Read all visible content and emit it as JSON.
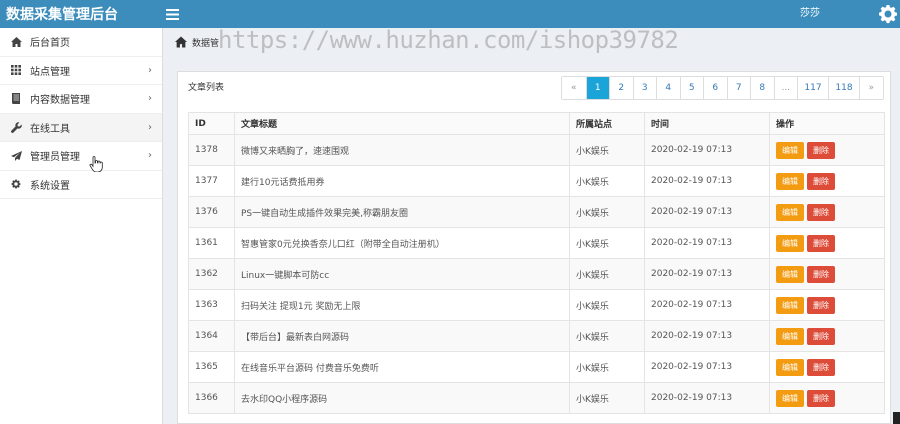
{
  "header": {
    "title": "数据采集管理后台",
    "user": "莎莎"
  },
  "sidebar": {
    "items": [
      {
        "label": "后台首页",
        "icon": "home-icon",
        "arrow": false
      },
      {
        "label": "站点管理",
        "icon": "grid-icon",
        "arrow": true
      },
      {
        "label": "内容数据管理",
        "icon": "book-icon",
        "arrow": true
      },
      {
        "label": "在线工具",
        "icon": "wrench-icon",
        "arrow": true
      },
      {
        "label": "管理员管理",
        "icon": "send-icon",
        "arrow": true
      },
      {
        "label": "系统设置",
        "icon": "gear-icon",
        "arrow": false
      }
    ]
  },
  "breadcrumb": {
    "label": "数据管"
  },
  "watermark": "https://www.huzhan.com/ishop39782",
  "panel": {
    "title": "文章列表"
  },
  "pagination": [
    "«",
    "1",
    "2",
    "3",
    "4",
    "5",
    "6",
    "7",
    "8",
    "...",
    "117",
    "118",
    "»"
  ],
  "table": {
    "headers": [
      "ID",
      "文章标题",
      "所属站点",
      "时间",
      "操作"
    ],
    "edit_label": "编辑",
    "delete_label": "删除",
    "rows": [
      {
        "id": "1378",
        "title": "微博又来晒胸了，速速围观",
        "site": "小K娱乐",
        "time": "2020-02-19 07:13"
      },
      {
        "id": "1377",
        "title": "建行10元话费抵用券",
        "site": "小K娱乐",
        "time": "2020-02-19 07:13"
      },
      {
        "id": "1376",
        "title": "PS一键自动生成插件效果完美,称霸朋友圈",
        "site": "小K娱乐",
        "time": "2020-02-19 07:13"
      },
      {
        "id": "1361",
        "title": "智惠管家0元兑换香奈儿口红（附带全自动注册机）",
        "site": "小K娱乐",
        "time": "2020-02-19 07:13"
      },
      {
        "id": "1362",
        "title": "Linux一键脚本可防cc",
        "site": "小K娱乐",
        "time": "2020-02-19 07:13"
      },
      {
        "id": "1363",
        "title": "扫码关注 提现1元 奖励无上限",
        "site": "小K娱乐",
        "time": "2020-02-19 07:13"
      },
      {
        "id": "1364",
        "title": "【带后台】最新表白网源码",
        "site": "小K娱乐",
        "time": "2020-02-19 07:13"
      },
      {
        "id": "1365",
        "title": "在线音乐平台源码 付费音乐免费听",
        "site": "小K娱乐",
        "time": "2020-02-19 07:13"
      },
      {
        "id": "1366",
        "title": "去水印QQ小程序源码",
        "site": "小K娱乐",
        "time": "2020-02-19 07:13"
      }
    ]
  }
}
